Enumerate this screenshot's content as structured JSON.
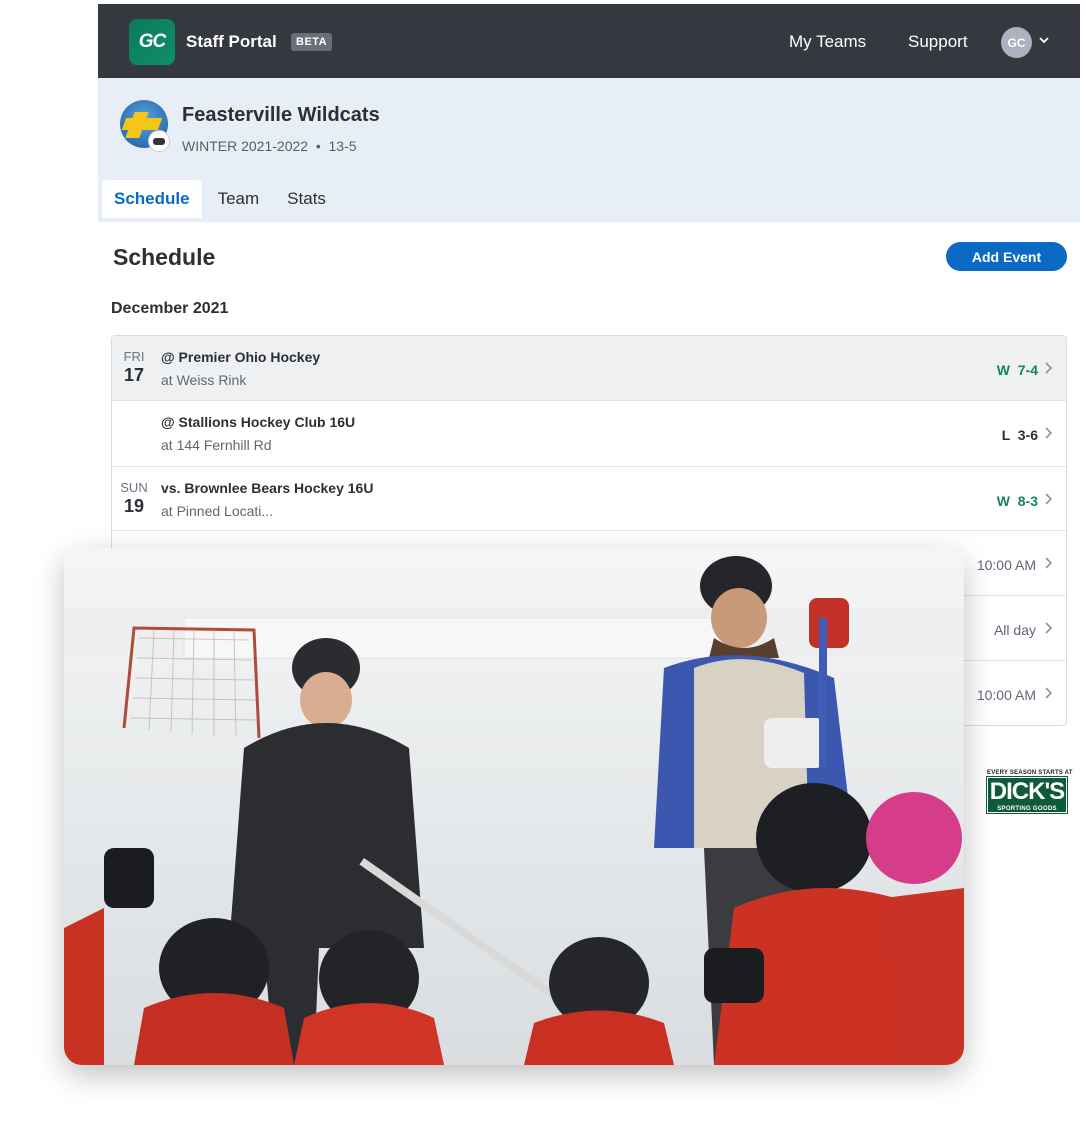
{
  "topnav": {
    "logo_text": "GC",
    "title": "Staff Portal",
    "badge": "BETA",
    "links": [
      "My Teams",
      "Support"
    ],
    "avatar_initials": "GC"
  },
  "team": {
    "name": "Feasterville Wildcats",
    "season": "WINTER 2021-2022",
    "record": "13-5",
    "meta": "WINTER 2021-2022  •  13-5",
    "tabs": [
      "Schedule",
      "Team",
      "Stats"
    ]
  },
  "schedule": {
    "title": "Schedule",
    "add_button": "Add Event",
    "month": "December 2021",
    "events": [
      {
        "dow": "FRI",
        "day": "17",
        "title": "@ Premier Ohio Hockey",
        "location": "at Weiss Rink",
        "result": "W  7-4",
        "outcome": "win"
      },
      {
        "dow": "",
        "day": "",
        "title": "@ Stallions Hockey Club 16U",
        "location": "at 144 Fernhill Rd",
        "result": "L  3-6",
        "outcome": "loss"
      },
      {
        "dow": "SUN",
        "day": "19",
        "title": "vs. Brownlee Bears Hockey 16U",
        "location": "at Pinned Locati...",
        "result": "W  8-3",
        "outcome": "win"
      },
      {
        "dow": "",
        "day": "",
        "title": "",
        "location": "",
        "result": "10:00 AM",
        "outcome": "time"
      },
      {
        "dow": "",
        "day": "",
        "title": "",
        "location": "",
        "result": "All day",
        "outcome": "time"
      },
      {
        "dow": "",
        "day": "",
        "title": "",
        "location": "",
        "result": "10:00 AM",
        "outcome": "time"
      }
    ]
  },
  "sponsor": {
    "tagline": "EVERY SEASON STARTS AT",
    "brand": "DICK'S",
    "sub": "SPORTING GOODS"
  },
  "colors": {
    "nav_bg": "#35383f",
    "accent_blue": "#0b6ac4",
    "win_green": "#16855a",
    "header_bg": "#e7eef8"
  }
}
